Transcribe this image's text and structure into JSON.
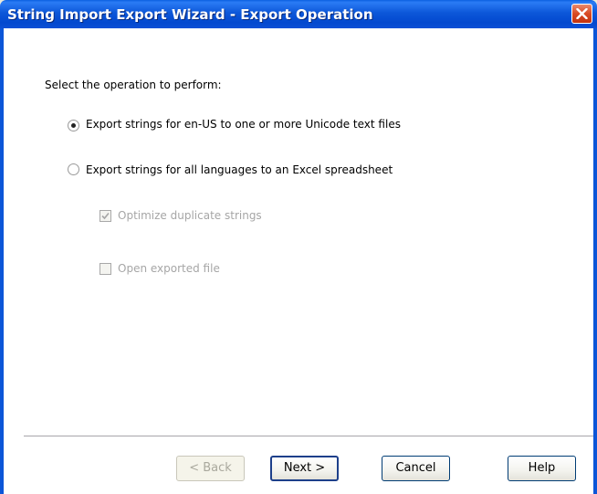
{
  "window": {
    "title": "String Import Export Wizard - Export Operation",
    "close_icon": "close-icon"
  },
  "main": {
    "prompt": "Select the operation to perform:",
    "options": [
      {
        "label": "Export strings for en-US to one or more Unicode text files",
        "selected": true
      },
      {
        "label": "Export strings for all languages to an Excel spreadsheet",
        "selected": false
      }
    ],
    "checkboxes": [
      {
        "label": "Optimize duplicate strings",
        "checked": true,
        "enabled": false
      },
      {
        "label": "Open exported file",
        "checked": false,
        "enabled": false
      }
    ]
  },
  "footer": {
    "back_label": "< Back",
    "next_label": "Next >",
    "cancel_label": "Cancel",
    "help_label": "Help"
  },
  "colors": {
    "titlebar": "#0a5fe0",
    "close": "#d94a23",
    "dialog_bg": "#ffffff",
    "frame": "#0c56d8"
  }
}
